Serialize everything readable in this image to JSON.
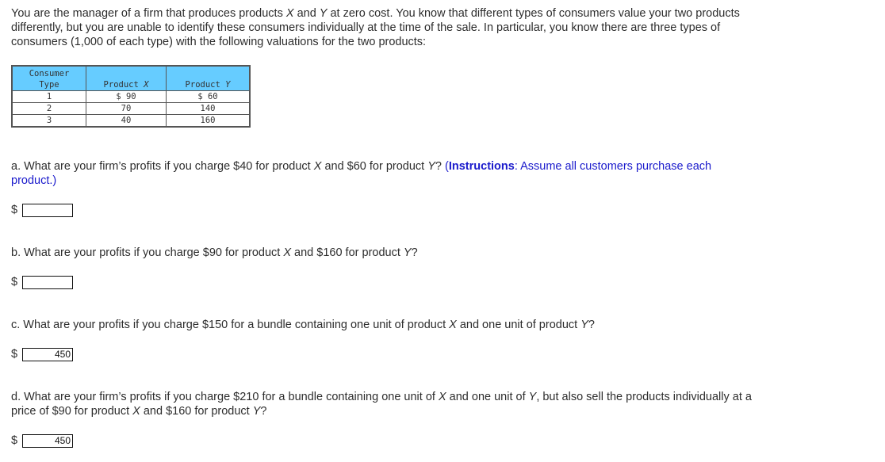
{
  "intro": {
    "part1": "You are the manager of a firm that produces products ",
    "var_x": "X",
    "part2": " and ",
    "var_y": "Y",
    "part3": " at zero cost. You know that different types of consumers value your two products differently, but you are unable to identify these consumers individually at the time of the sale. In particular, you know there are three types of consumers (1,000 of each type) with the following valuations for the two products:"
  },
  "table": {
    "headers": {
      "consumer_line1": "Consumer",
      "consumer_line2": "Type",
      "product_x_prefix": "Product ",
      "product_x_var": "X",
      "product_y_prefix": "Product ",
      "product_y_var": "Y"
    },
    "rows": [
      {
        "type": "1",
        "x": "$ 90",
        "y": "$ 60"
      },
      {
        "type": "2",
        "x": "70",
        "y": "140"
      },
      {
        "type": "3",
        "x": "40",
        "y": "160"
      }
    ]
  },
  "questions": {
    "a": {
      "t1": "a. What are your firm’s profits if you charge $40 for product ",
      "vx": "X",
      "t2": " and $60 for product ",
      "vy": "Y",
      "t3": "?",
      "instr_label": "Instructions",
      "instr_text": ": Assume all customers purchase each product.)",
      "instr_open": " (",
      "currency": "$",
      "answer": ""
    },
    "b": {
      "t1": "b. What are your profits if you charge $90 for product ",
      "vx": "X",
      "t2": " and $160 for product ",
      "vy": "Y",
      "t3": "?",
      "currency": "$",
      "answer": ""
    },
    "c": {
      "t1": "c. What are your profits if you charge $150 for a bundle containing one unit of product ",
      "vx": "X",
      "t2": " and one unit of product ",
      "vy": "Y",
      "t3": "?",
      "currency": "$",
      "answer": "450"
    },
    "d": {
      "t1": "d. What are your firm’s profits if you charge $210 for a bundle containing one unit of ",
      "vx": "X",
      "t2": " and one unit of ",
      "vy": "Y",
      "t3": ", but also sell the products individually at a price of $90 for product ",
      "vx2": "X",
      "t4": " and $160 for product ",
      "vy2": "Y",
      "t5": "?",
      "currency": "$",
      "answer": "450"
    }
  },
  "colors": {
    "table_header_bg": "#66ccff",
    "instruction_text": "#1a1acc",
    "body_text": "#2d2d2d"
  }
}
